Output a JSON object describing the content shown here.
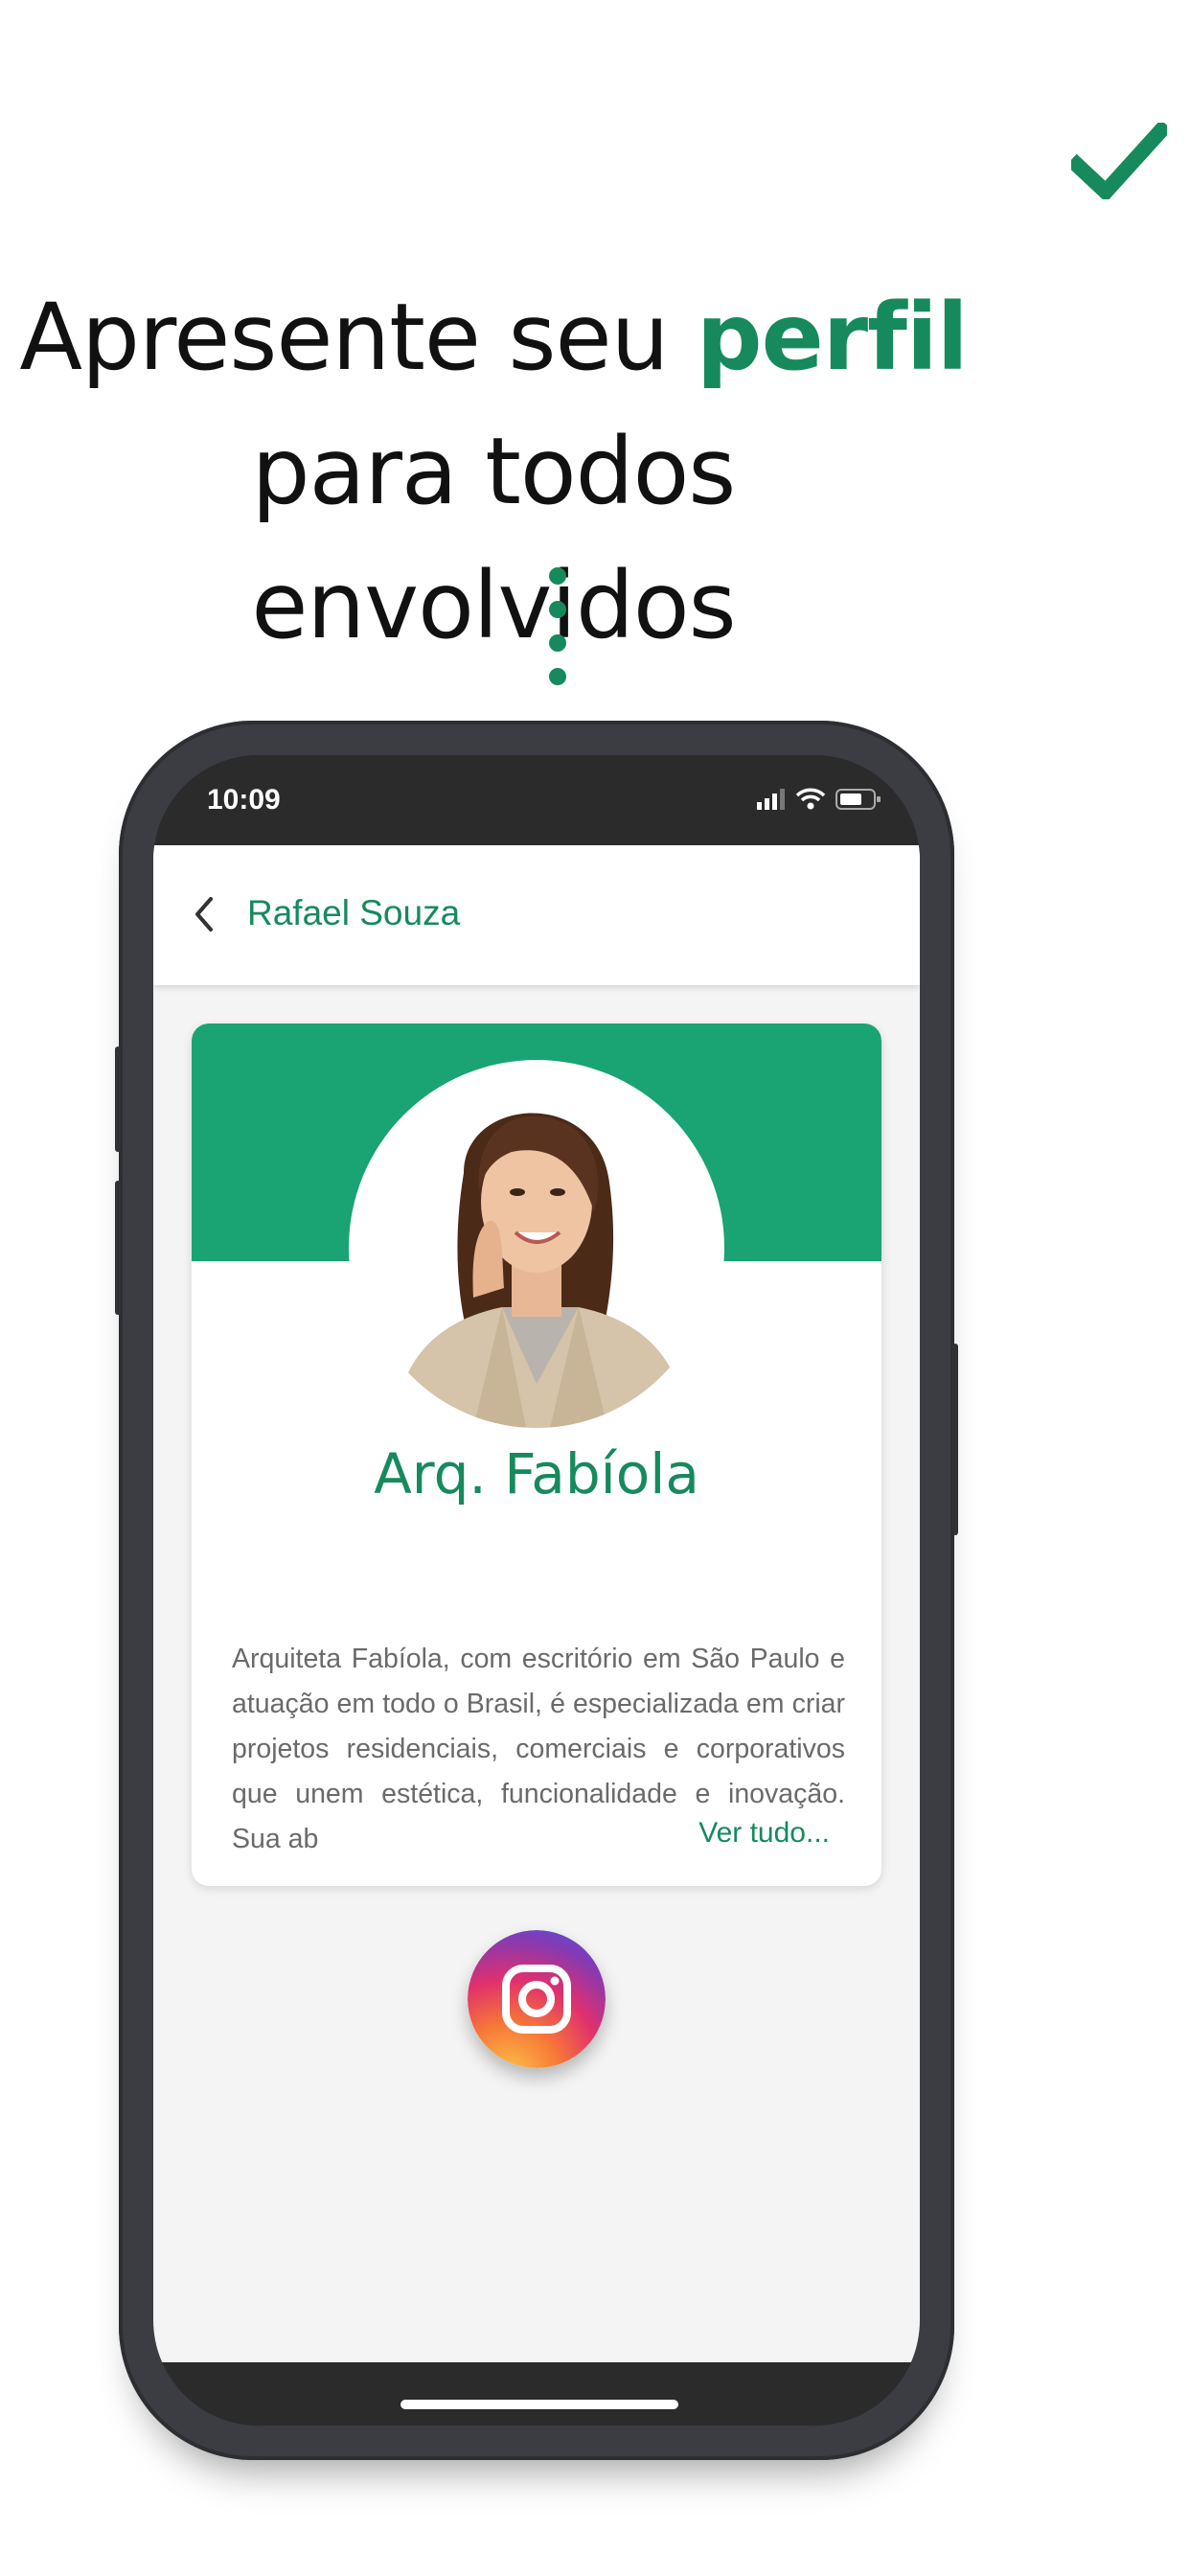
{
  "headline": {
    "line1_prefix": "Apresente seu ",
    "line1_accent": "perfil",
    "line2": "para todos envolvidos"
  },
  "colors": {
    "accent": "#168a5c",
    "banner": "#1aa373",
    "phone_frame": "#3b3d42"
  },
  "icons": {
    "top": "checkmark-icon",
    "back": "chevron-left-icon",
    "social": "instagram-icon"
  },
  "status_bar": {
    "time": "10:09"
  },
  "nav": {
    "title": "Rafael Souza"
  },
  "profile": {
    "name": "Arq. Fabíola",
    "bio": "Arquiteta Fabíola, com escritório em São Paulo e atuação em todo o Brasil, é especializada em criar projetos residenciais, comerciais e corporativos que unem estética, funcionalidade e inovação. Sua ab",
    "see_more": "Ver tudo..."
  }
}
